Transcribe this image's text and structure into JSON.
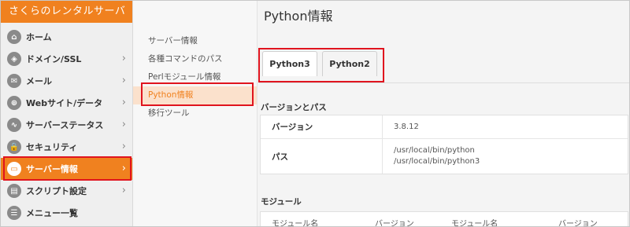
{
  "brand": {
    "title": "さくらのレンタルサーバ"
  },
  "sidebar": {
    "items": [
      {
        "label": "ホーム",
        "icon": "home-icon",
        "glyph": "⌂",
        "chevron": false
      },
      {
        "label": "ドメイン/SSL",
        "icon": "domain-icon",
        "glyph": "◈",
        "chevron": true
      },
      {
        "label": "メール",
        "icon": "mail-icon",
        "glyph": "✉",
        "chevron": true
      },
      {
        "label": "Webサイト/データ",
        "icon": "globe-icon",
        "glyph": "⊕",
        "chevron": true
      },
      {
        "label": "サーバーステータス",
        "icon": "chart-icon",
        "glyph": "∿",
        "chevron": true
      },
      {
        "label": "セキュリティ",
        "icon": "lock-icon",
        "glyph": "🔒",
        "chevron": true
      },
      {
        "label": "サーバー情報",
        "icon": "server-icon",
        "glyph": "▭",
        "chevron": true,
        "active": true
      },
      {
        "label": "スクリプト設定",
        "icon": "script-icon",
        "glyph": "▤",
        "chevron": true
      },
      {
        "label": "メニュー一覧",
        "icon": "list-icon",
        "glyph": "☰",
        "chevron": false
      }
    ],
    "chevron_glyph": "›"
  },
  "subnav": {
    "items": [
      "サーバー情報",
      "各種コマンドのパス",
      "Perlモジュール情報",
      "Python情報",
      "移行ツール"
    ],
    "active_index": 3
  },
  "main": {
    "title": "Python情報",
    "tabs": [
      {
        "label": "Python3",
        "active": true
      },
      {
        "label": "Python2",
        "active": false
      }
    ],
    "version_section": {
      "title": "バージョンとパス",
      "rows": [
        {
          "key": "バージョン",
          "values": [
            "3.8.12"
          ]
        },
        {
          "key": "パス",
          "values": [
            "/usr/local/bin/python",
            "/usr/local/bin/python3"
          ]
        }
      ]
    },
    "module_section": {
      "title": "モジュール",
      "headers": [
        "モジュール名",
        "バージョン",
        "モジュール名",
        "バージョン"
      ]
    }
  },
  "colors": {
    "brand": "#f0811f",
    "highlight": "#e0141e",
    "active_sub_bg": "#fbe1cc"
  }
}
